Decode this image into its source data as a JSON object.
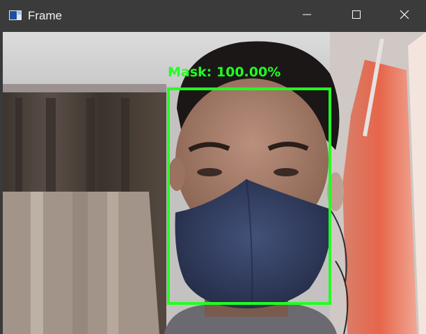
{
  "window": {
    "title": "Frame",
    "icons": {
      "app": "app-frame-icon",
      "minimize": "minimize-icon",
      "maximize": "maximize-icon",
      "close": "close-icon"
    }
  },
  "detection": {
    "label": "Mask: 100.00%",
    "color": "#22ff22"
  }
}
